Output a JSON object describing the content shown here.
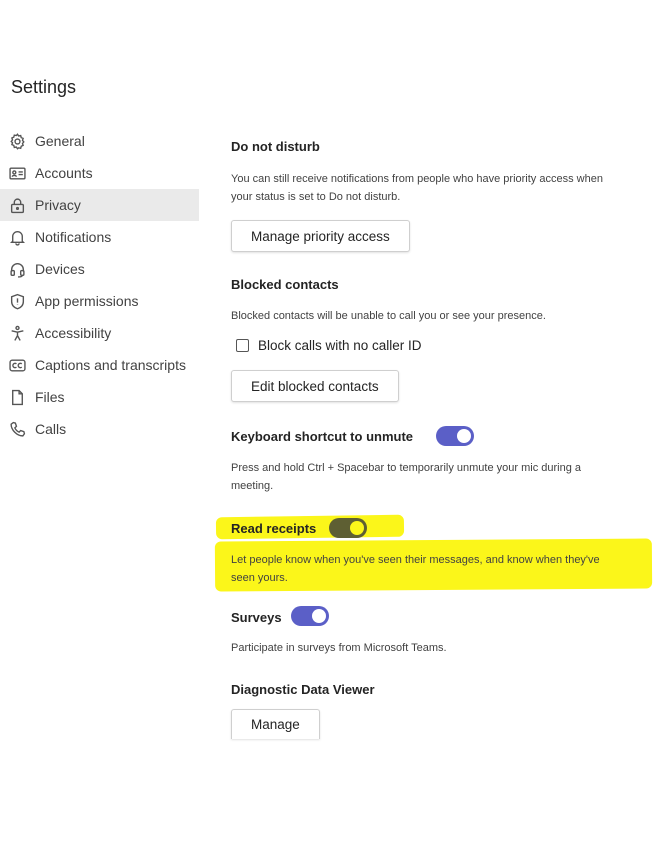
{
  "page": {
    "title": "Settings"
  },
  "nav": {
    "items": [
      {
        "label": "General",
        "icon": "gear-icon"
      },
      {
        "label": "Accounts",
        "icon": "id-card-icon"
      },
      {
        "label": "Privacy",
        "icon": "lock-icon",
        "active": true
      },
      {
        "label": "Notifications",
        "icon": "bell-icon"
      },
      {
        "label": "Devices",
        "icon": "headset-icon"
      },
      {
        "label": "App permissions",
        "icon": "shield-icon"
      },
      {
        "label": "Accessibility",
        "icon": "accessibility-icon"
      },
      {
        "label": "Captions and transcripts",
        "icon": "captions-icon"
      },
      {
        "label": "Files",
        "icon": "file-icon"
      },
      {
        "label": "Calls",
        "icon": "phone-icon"
      }
    ]
  },
  "dnd": {
    "heading": "Do not disturb",
    "desc": "You can still receive notifications from people who have priority access when your status is set to Do not disturb.",
    "button": "Manage priority access"
  },
  "blocked": {
    "heading": "Blocked contacts",
    "desc": "Blocked contacts will be unable to call you or see your presence.",
    "checkbox_label": "Block calls with no caller ID",
    "checkbox_checked": false,
    "button": "Edit blocked contacts"
  },
  "shortcut": {
    "heading": "Keyboard shortcut to unmute",
    "toggle_on": true,
    "desc": "Press and hold Ctrl + Spacebar to temporarily unmute your mic during a meeting."
  },
  "receipts": {
    "heading": "Read receipts",
    "toggle_on": true,
    "desc": "Let people know when you've seen their messages, and know when they've seen yours."
  },
  "surveys": {
    "heading": "Surveys",
    "toggle_on": true,
    "desc": "Participate in surveys from Microsoft Teams."
  },
  "diagnostic": {
    "heading": "Diagnostic Data Viewer",
    "button": "Manage"
  },
  "colors": {
    "accent": "#5b5fc7",
    "highlight": "#fbf61a",
    "active_nav": "#eaeaea"
  }
}
